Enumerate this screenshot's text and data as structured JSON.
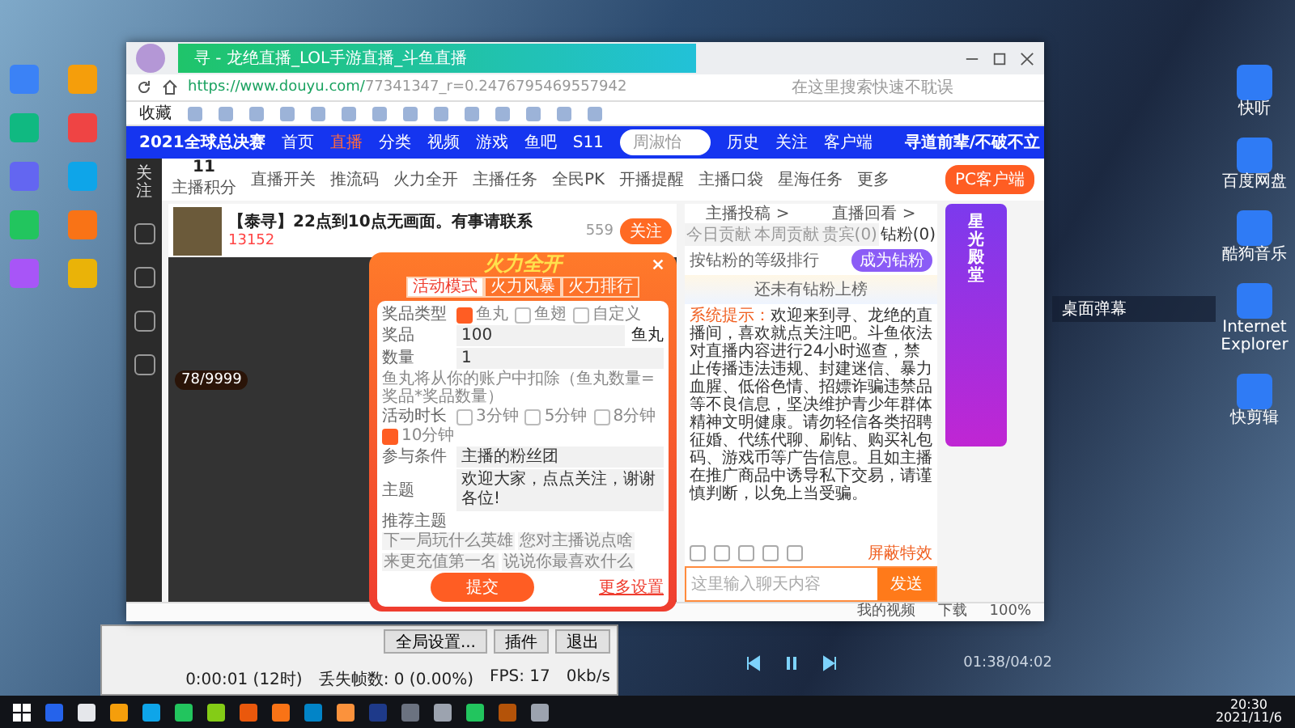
{
  "browser": {
    "tab_title": "寻 - 龙绝直播_LOL手游直播_斗鱼直播",
    "url_host": "https://www.douyu.com/",
    "url_path": "77341347_r=0.2476795469557942",
    "search_placeholder": "在这里搜索快速不耽误",
    "bookmarks": [
      "收藏"
    ],
    "status_items": [
      "我的视频",
      "下载",
      "100%"
    ]
  },
  "site_nav": {
    "logo": "2021全球总决赛",
    "items": [
      {
        "label": "首页",
        "selected": false
      },
      {
        "label": "直播",
        "selected": true
      },
      {
        "label": "分类",
        "selected": false
      },
      {
        "label": "视频",
        "selected": false
      },
      {
        "label": "游戏",
        "selected": false
      },
      {
        "label": "鱼吧",
        "selected": false
      },
      {
        "label": "S11",
        "selected": false
      }
    ],
    "search_placeholder": "周淑怡",
    "actions": [
      "历史",
      "关注",
      "客户端"
    ],
    "username": "寻道前辈/不破不立"
  },
  "sidebar": [
    {
      "label": "关注"
    }
  ],
  "toolbar": {
    "score": "11",
    "score_label": "主播积分",
    "items": [
      "直播开关",
      "推流码",
      "火力全开",
      "主播任务",
      "全民PK",
      "开播提醒",
      "主播口袋",
      "星海任务",
      "更多"
    ],
    "client_button": "PC客户端"
  },
  "room": {
    "title": "【泰寻】22点到10点无画面。有事请联系",
    "heat": "13152",
    "follow_count": "559",
    "follow": "关注",
    "rank": "78/9999"
  },
  "popup": {
    "title": "火力全开",
    "tabs": [
      {
        "label": "活动模式",
        "selected": true
      },
      {
        "label": "火力风暴",
        "selected": false
      },
      {
        "label": "火力排行",
        "selected": false
      }
    ],
    "prize_type_label": "奖品类型",
    "prize_types": [
      {
        "label": "鱼丸",
        "checked": true
      },
      {
        "label": "鱼翅",
        "checked": false
      },
      {
        "label": "自定义",
        "checked": false
      }
    ],
    "prize_label": "奖品",
    "prize_value": "100",
    "prize_unit": "鱼丸",
    "count_label": "数量",
    "count_value": "1",
    "note": "鱼丸将从你的账户中扣除（鱼丸数量=奖品*奖品数量）",
    "duration_label": "活动时长",
    "durations": [
      {
        "label": "3分钟",
        "checked": false
      },
      {
        "label": "5分钟",
        "checked": false
      },
      {
        "label": "8分钟",
        "checked": false
      },
      {
        "label": "10分钟",
        "checked": true
      }
    ],
    "condition_label": "参与条件",
    "condition_value": "主播的粉丝团",
    "topic_label": "主题",
    "topic_value": "欢迎大家，点点关注，谢谢各位!",
    "suggest_label": "推荐主题",
    "suggestions": [
      "下一局玩什么英雄",
      "您对主播说点啥",
      "来更充值第一名",
      "说说你最喜欢什么"
    ],
    "submit": "提交",
    "more": "更多设置"
  },
  "chat": {
    "links": [
      "主播投稿 >",
      "直播回看 >"
    ],
    "tabs": [
      {
        "label": "今日贡献",
        "selected": false
      },
      {
        "label": "本周贡献",
        "selected": false
      },
      {
        "label": "贵宾(0)",
        "selected": false
      },
      {
        "label": "钻粉(0)",
        "selected": true
      }
    ],
    "rank_hint": "按钻粉的等级排行",
    "become_button": "成为钻粉",
    "empty": "还未有钻粉上榜",
    "system_label": "系统提示：",
    "system_text": "欢迎来到寻、龙绝的直播间，喜欢就点关注吧。斗鱼依法对直播内容进行24小时巡查，禁止传播违法违规、封建迷信、暴力血腥、低俗色情、招嫖诈骗违禁品等不良信息，坚决维护青少年群体精神文明健康。请勿轻信各类招聘征婚、代练代聊、刷钻、购买礼包码、游戏币等广告信息。且如主播在推广商品中诱导私下交易，请谨慎判断，以免上当受骗。",
    "block_effects": "屏蔽特效",
    "input_placeholder": "这里输入聊天内容",
    "send": "发送"
  },
  "side_widget": {
    "title": "星光殿堂"
  },
  "desktop": {
    "right_icons": [
      "快听",
      "百度网盘",
      "酷狗音乐",
      "Internet Explorer",
      "快剪辑"
    ],
    "danmu_title": "桌面弹幕",
    "music_time": "01:38/04:02"
  },
  "obs": {
    "buttons": [
      "全局设置...",
      "插件",
      "退出"
    ],
    "stats": [
      "0:00:01 (12时)",
      "丢失帧数: 0 (0.00%)",
      "FPS: 17",
      "0kb/s"
    ]
  },
  "taskbar": {
    "time": "20:30",
    "date": "2021/11/6"
  }
}
